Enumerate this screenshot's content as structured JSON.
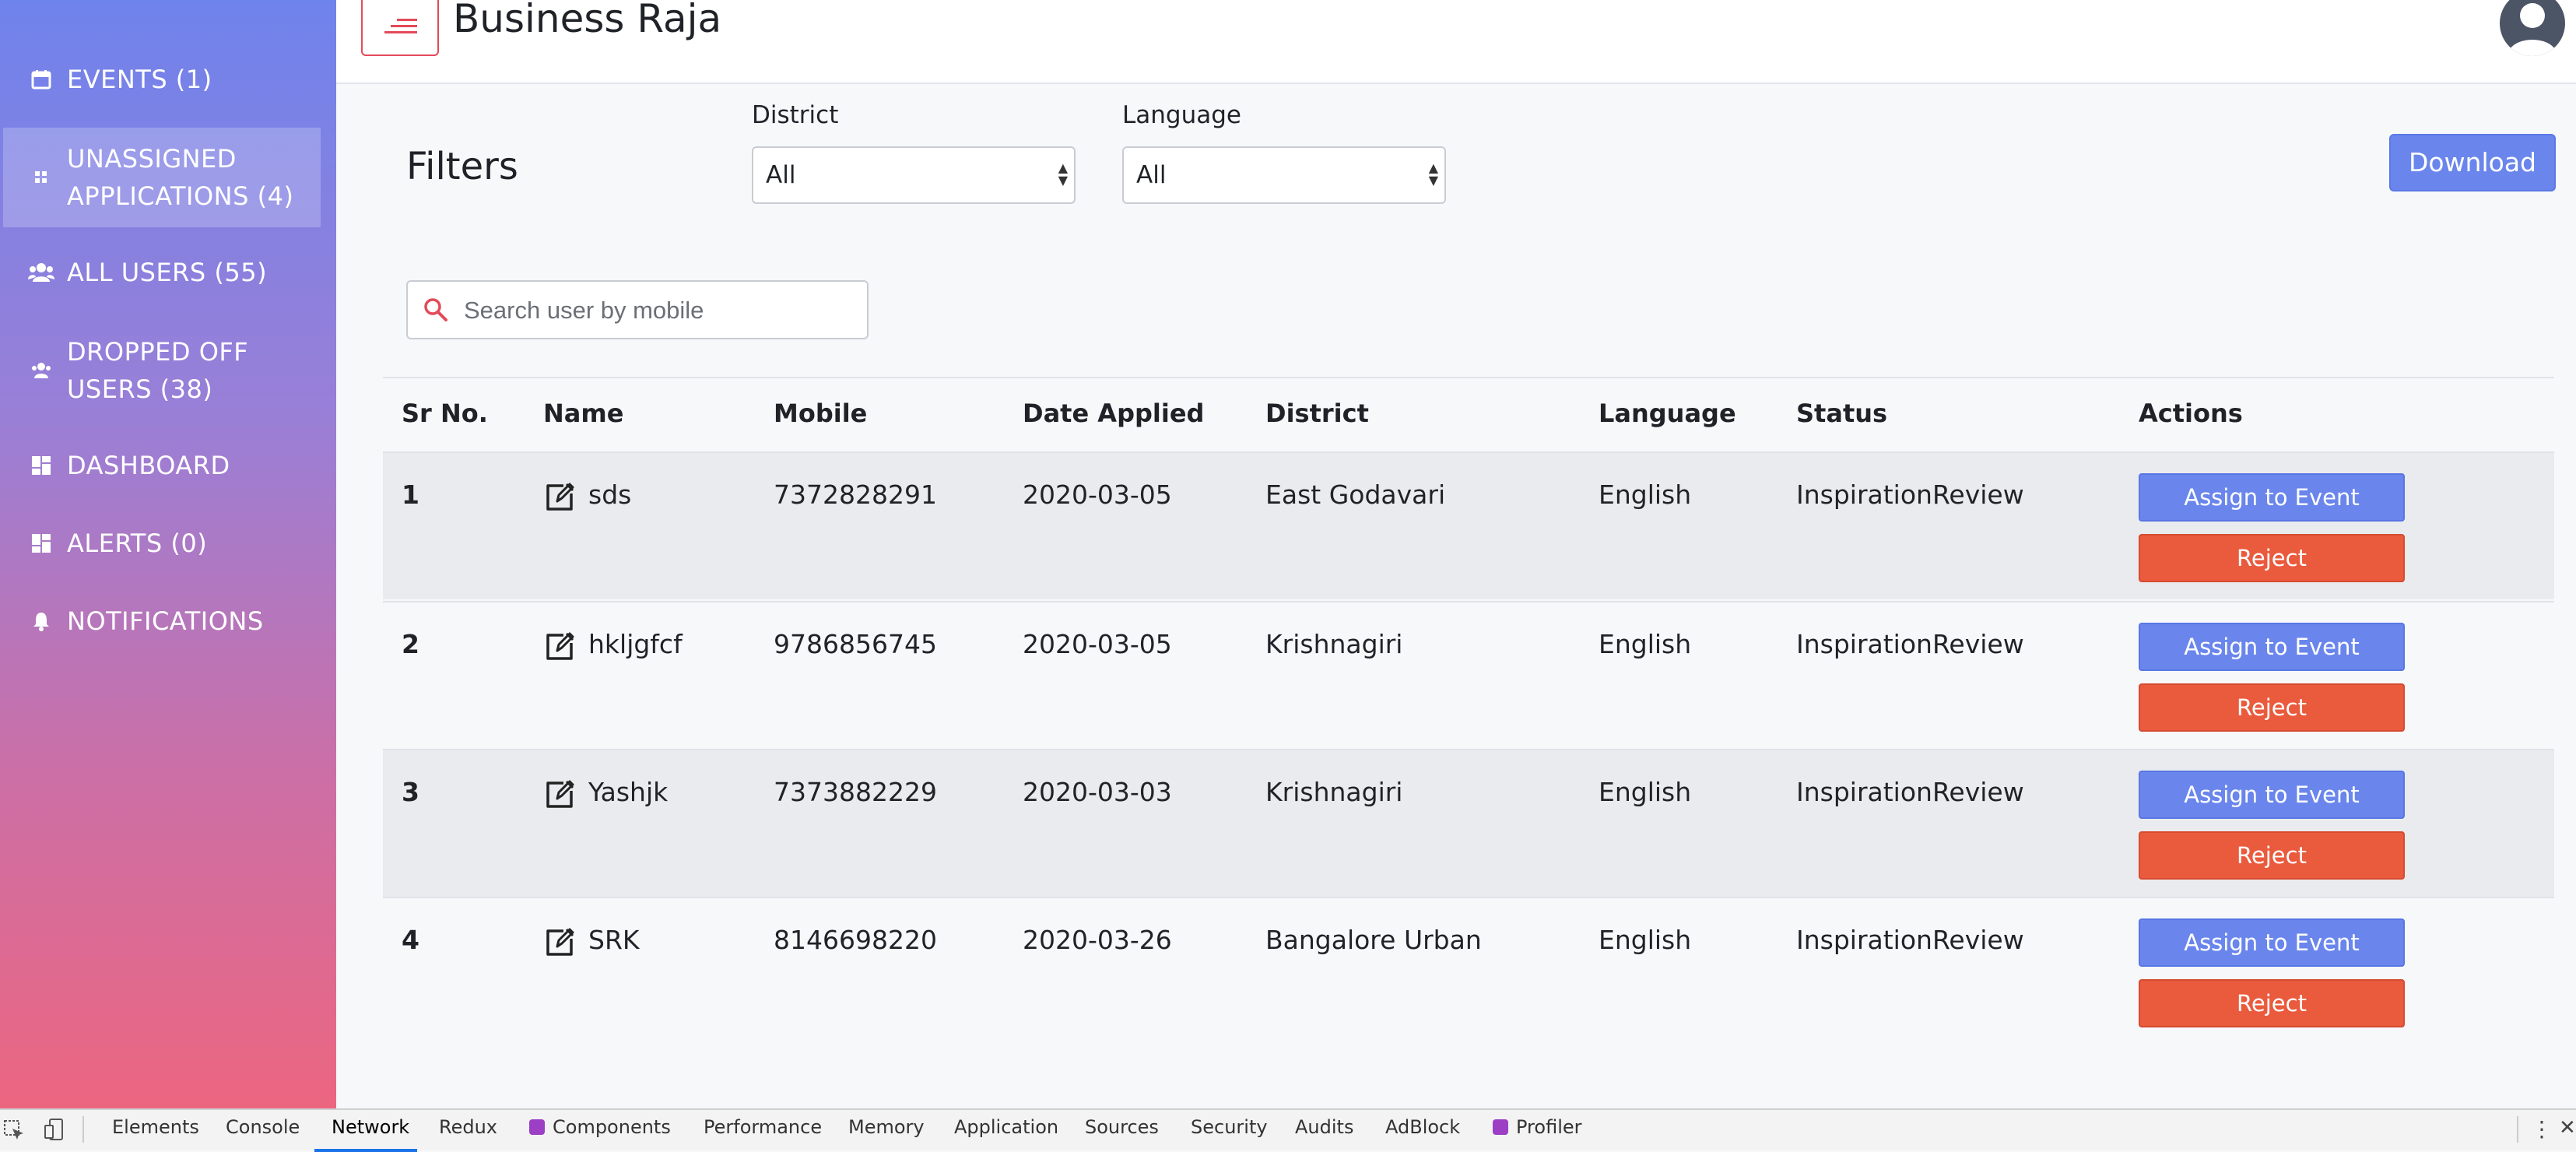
{
  "sidebar": {
    "items": [
      {
        "label": "EVENTS (1)",
        "icon": "calendar-icon"
      },
      {
        "label_line1": "UNASSIGNED",
        "label_line2": "APPLICATIONS (4)",
        "icon": "grid-small-icon"
      },
      {
        "label": "ALL USERS (55)",
        "icon": "users-icon"
      },
      {
        "label_line1": "DROPPED OFF",
        "label_line2": "USERS (38)",
        "icon": "users-dropped-icon"
      },
      {
        "label": "DASHBOARD",
        "icon": "dashboard-icon"
      },
      {
        "label": "ALERTS (0)",
        "icon": "dashboard-icon"
      },
      {
        "label": "NOTIFICATIONS",
        "icon": "bell-icon"
      }
    ],
    "gradient": [
      "#6f83ec",
      "#ec6680"
    ]
  },
  "header": {
    "title": "Business Raja",
    "menu_icon": "hamburger-icon",
    "avatar_icon": "user-avatar-icon"
  },
  "filters": {
    "title": "Filters",
    "district": {
      "label": "District",
      "value": "All"
    },
    "language": {
      "label": "Language",
      "value": "All"
    },
    "download_label": "Download"
  },
  "search": {
    "placeholder": "Search user by mobile",
    "icon": "search-icon"
  },
  "table": {
    "headers": [
      "Sr No.",
      "Name",
      "Mobile",
      "Date Applied",
      "District",
      "Language",
      "Status",
      "Actions"
    ],
    "rows": [
      {
        "sr": "1",
        "name": "sds",
        "mobile": "7372828291",
        "date": "2020-03-05",
        "district": "East Godavari",
        "language": "English",
        "status": "InspirationReview"
      },
      {
        "sr": "2",
        "name": "hkljgfcf",
        "mobile": "9786856745",
        "date": "2020-03-05",
        "district": "Krishnagiri",
        "language": "English",
        "status": "InspirationReview"
      },
      {
        "sr": "3",
        "name": "Yashjk",
        "mobile": "7373882229",
        "date": "2020-03-03",
        "district": "Krishnagiri",
        "language": "English",
        "status": "InspirationReview"
      },
      {
        "sr": "4",
        "name": "SRK",
        "mobile": "8146698220",
        "date": "2020-03-26",
        "district": "Bangalore Urban",
        "language": "English",
        "status": "InspirationReview"
      }
    ],
    "assign_label": "Assign to Event",
    "reject_label": "Reject"
  },
  "devtools": {
    "tabs": [
      "Elements",
      "Console",
      "Network",
      "Redux",
      "Components",
      "Performance",
      "Memory",
      "Application",
      "Sources",
      "Security",
      "Audits",
      "AdBlock",
      "Profiler"
    ],
    "selected": "Network"
  },
  "colors": {
    "primary": "#6a86ec",
    "danger": "#ea5a3d",
    "accent": "#e34a5a",
    "row_shade": "#eaebee"
  }
}
